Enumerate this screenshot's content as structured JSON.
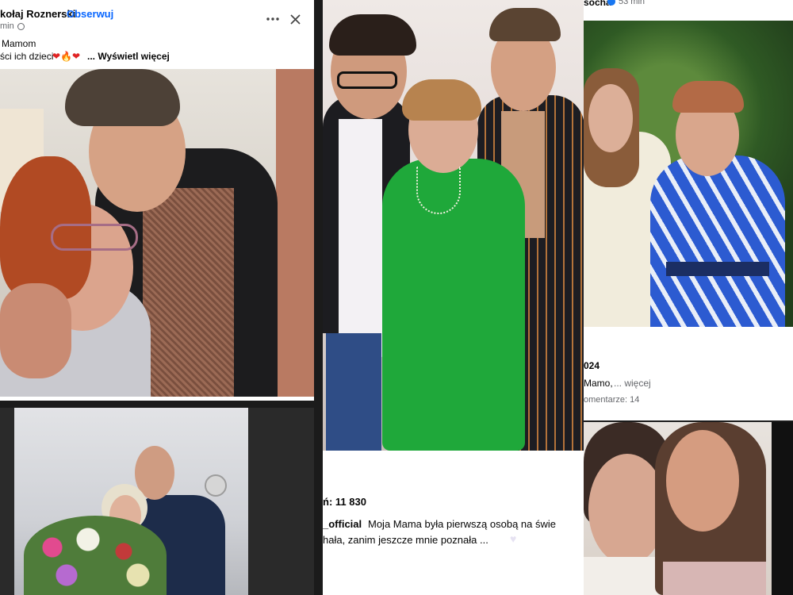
{
  "fb_post": {
    "author": "kołaj Roznerski",
    "follow": "Obserwuj",
    "time": "min ·",
    "line1": "Mamom",
    "line2": "ści ich dzieci",
    "emoji": "❤🔥❤",
    "more": "... Wyświetl więcej",
    "more_icon": "more-horizontal-icon",
    "close_icon": "close-icon"
  },
  "center_post": {
    "likes": "ń: 11 830",
    "username": "_official",
    "caption_line1": "Moja Mama była pierwszą osobą na świe",
    "caption_line2": "hała, zanim jeszcze mnie poznała ..."
  },
  "right_post": {
    "author": "socha",
    "time": "53 min",
    "year": "024",
    "caption": "Mamo,",
    "more": "... więcej",
    "comments": "omentarze: 14"
  },
  "colors": {
    "facebook_blue": "#0866ff",
    "verified_blue": "#1877f2",
    "green_dress": "#1fa83a",
    "blue_dress": "#2c5bd1"
  }
}
